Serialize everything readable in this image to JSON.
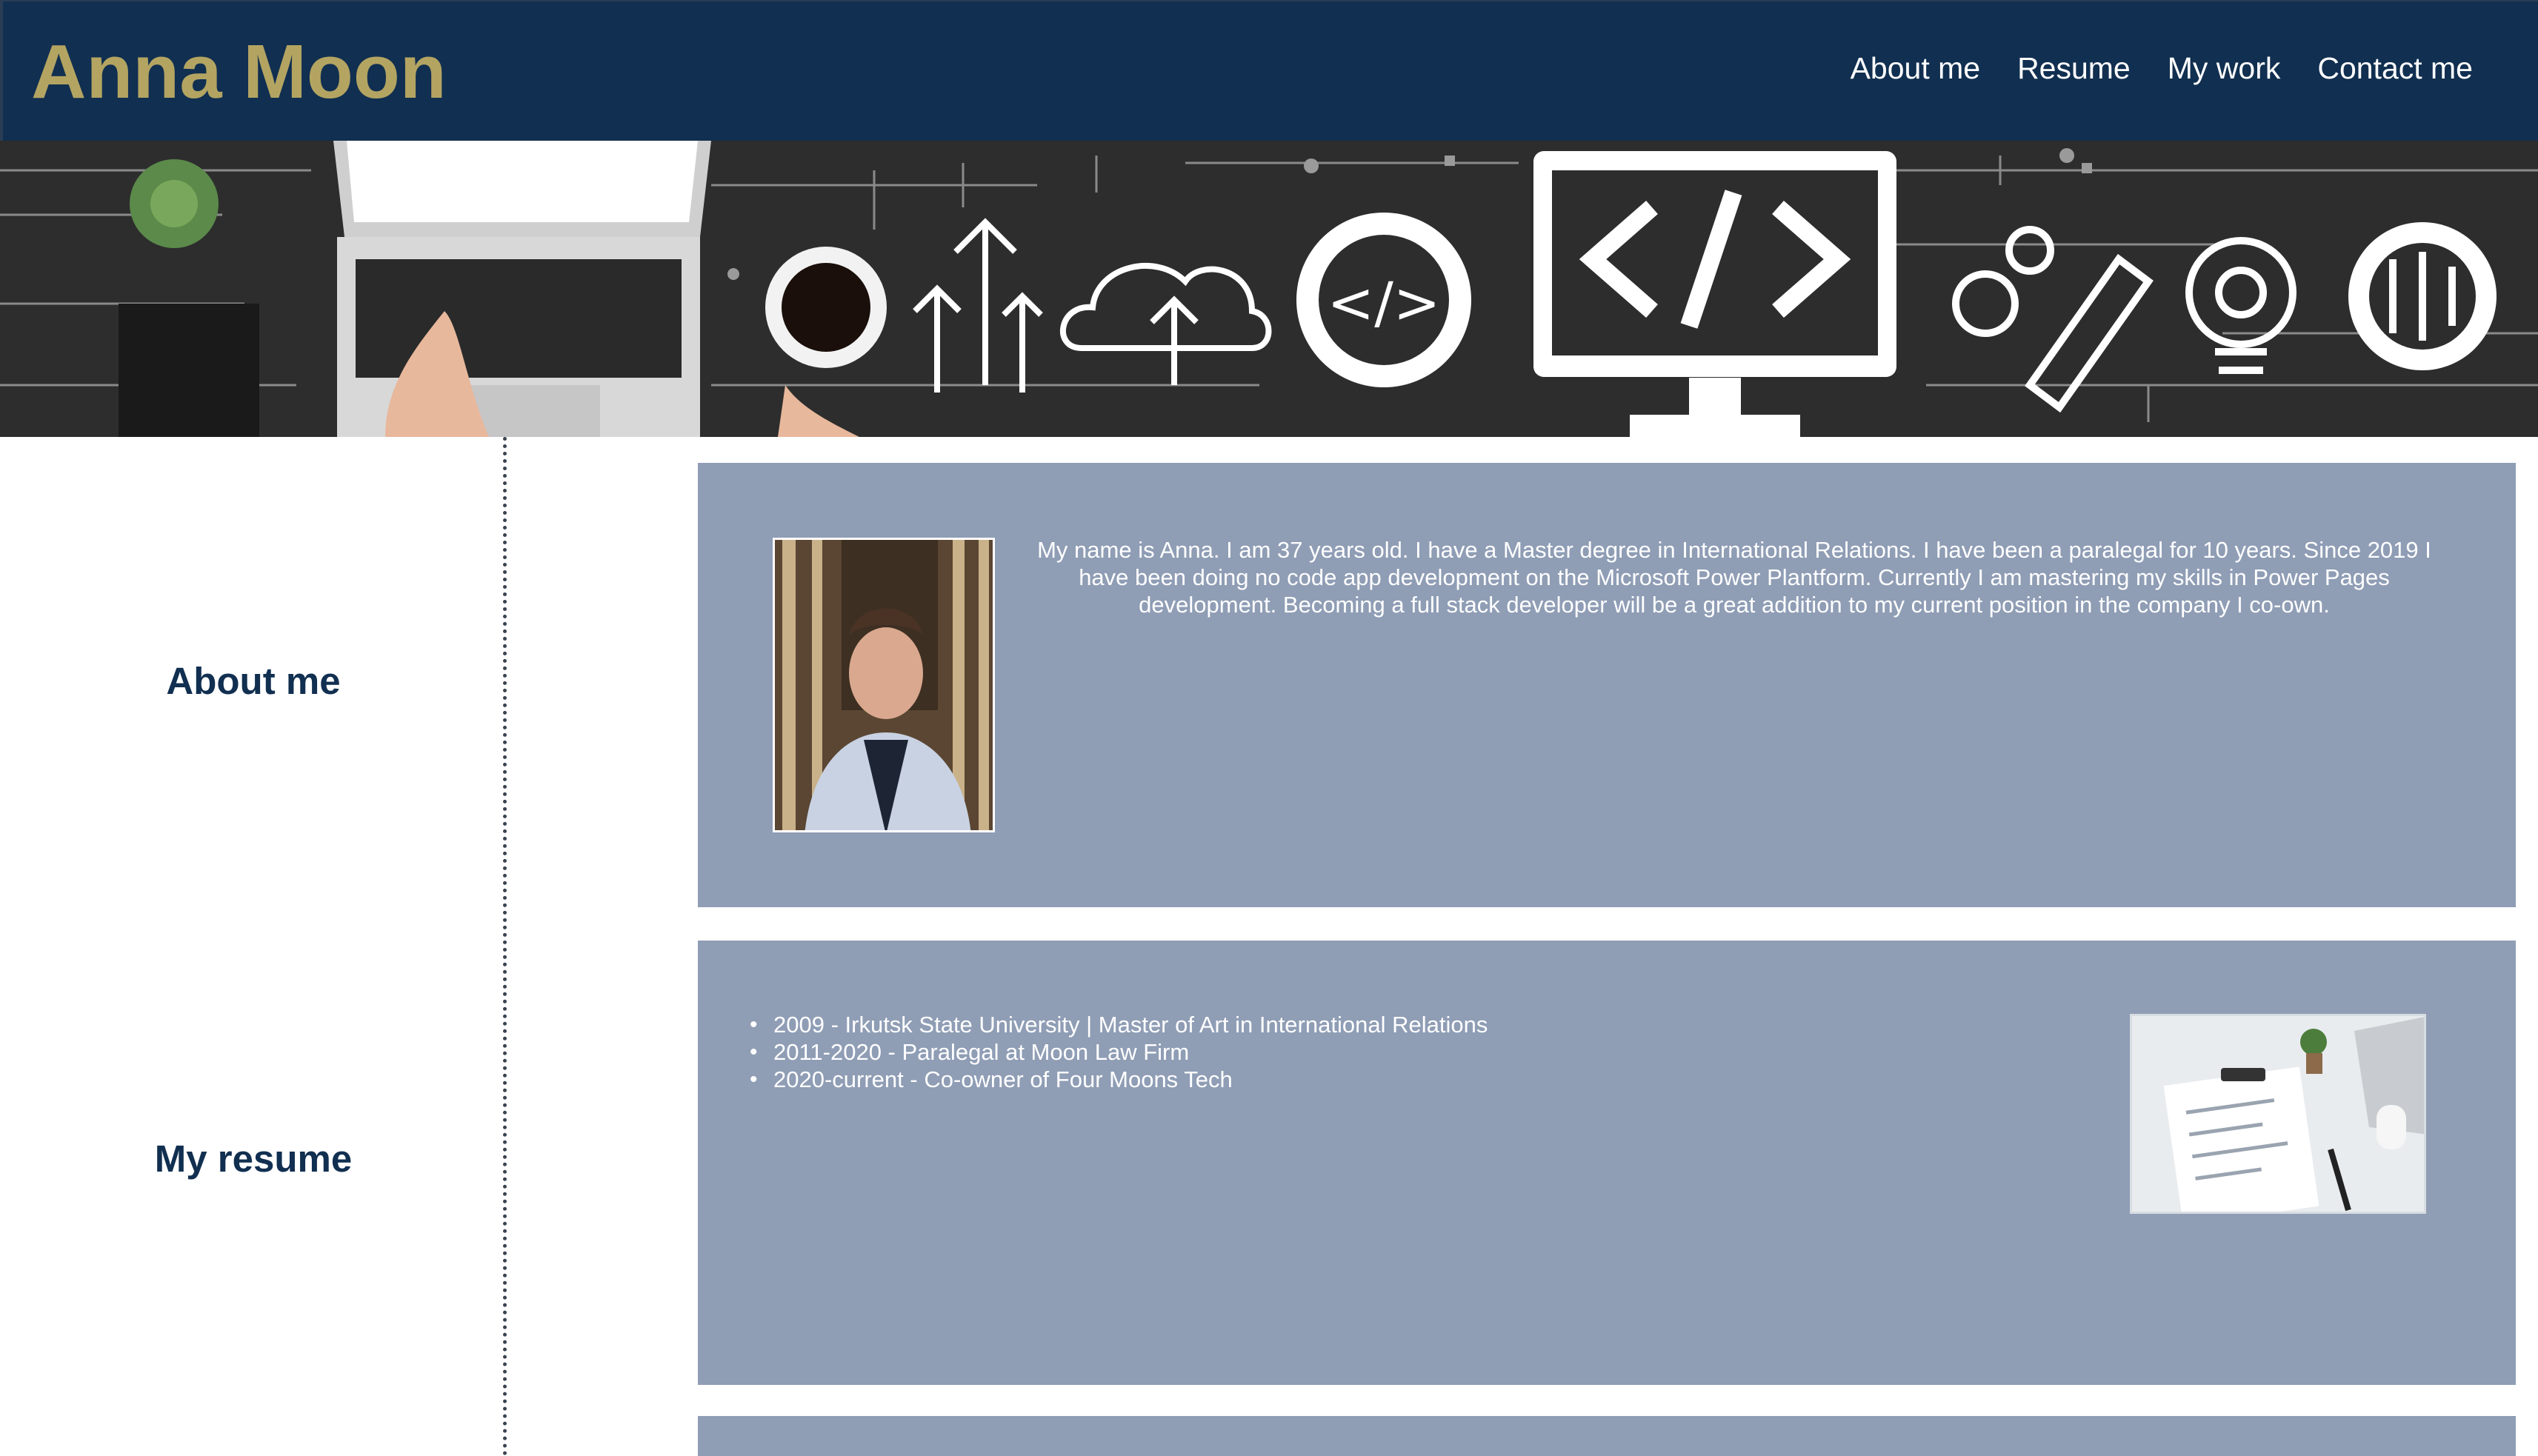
{
  "header": {
    "brand": "Anna Moon",
    "nav": [
      "About me",
      "Resume",
      "My work",
      "Contact me"
    ]
  },
  "sidebar": {
    "about_title": "About me",
    "resume_title": "My resume"
  },
  "about": {
    "text": "My name is Anna. I am 37 years old. I have a Master degree in International Relations. I have been a paralegal for 10 years. Since 2019 I have been doing no code app development on the Microsoft Power Plantform. Currently I am mastering my skills in Power Pages development. Becoming a full stack developer will be a great addition to my current position in the company I co-own."
  },
  "resume": {
    "items": [
      "2009 - Irkutsk State University | Master of Art in International Relations",
      "2011-2020 - Paralegal at Moon Law Firm",
      "2020-current - Co-owner of Four Moons Tech"
    ]
  },
  "banner_code_glyph": "</>",
  "colors": {
    "header_bg": "#112f50",
    "brand": "#b3a462",
    "section_bg": "#8f9db5",
    "sidebar_title": "#112f50"
  }
}
